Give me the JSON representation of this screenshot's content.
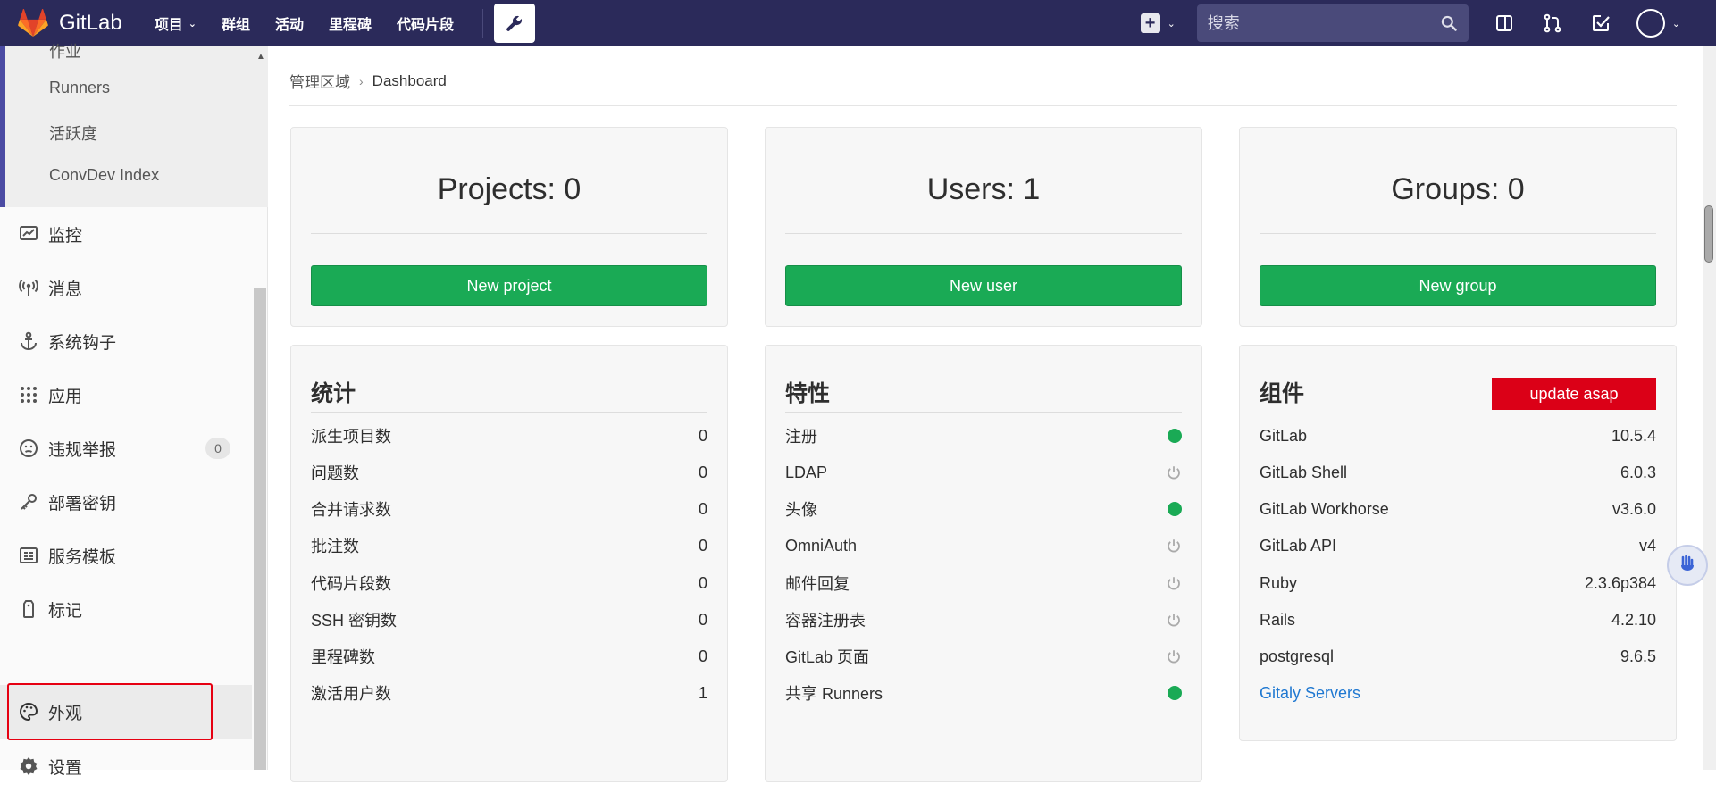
{
  "navbar": {
    "brand": "GitLab",
    "links": [
      {
        "label": "项目",
        "dropdown": true
      },
      {
        "label": "群组"
      },
      {
        "label": "活动"
      },
      {
        "label": "里程碑"
      },
      {
        "label": "代码片段"
      }
    ],
    "search_placeholder": "搜索",
    "accent": "#2b2a5a"
  },
  "sidebar": {
    "sub_items": [
      "作业",
      "Runners",
      "活跃度",
      "ConvDev Index"
    ],
    "items": [
      {
        "label": "监控",
        "icon": "monitor-icon"
      },
      {
        "label": "消息",
        "icon": "broadcast-icon"
      },
      {
        "label": "系统钩子",
        "icon": "anchor-icon"
      },
      {
        "label": "应用",
        "icon": "grid-icon"
      },
      {
        "label": "违规举报",
        "icon": "abuse-icon",
        "badge": "0"
      },
      {
        "label": "部署密钥",
        "icon": "key-icon"
      },
      {
        "label": "服务模板",
        "icon": "template-icon"
      },
      {
        "label": "标记",
        "icon": "label-icon"
      },
      {
        "label": "外观",
        "icon": "palette-icon",
        "active": true
      },
      {
        "label": "设置",
        "icon": "gear-icon"
      }
    ]
  },
  "breadcrumb": {
    "parent": "管理区域",
    "current": "Dashboard"
  },
  "stats": [
    {
      "title": "Projects: 0",
      "button": "New project"
    },
    {
      "title": "Users: 1",
      "button": "New user"
    },
    {
      "title": "Groups: 0",
      "button": "New group"
    }
  ],
  "statistics": {
    "title": "统计",
    "rows": [
      {
        "label": "派生项目数",
        "value": "0"
      },
      {
        "label": "问题数",
        "value": "0"
      },
      {
        "label": "合并请求数",
        "value": "0"
      },
      {
        "label": "批注数",
        "value": "0"
      },
      {
        "label": "代码片段数",
        "value": "0"
      },
      {
        "label": "SSH 密钥数",
        "value": "0"
      },
      {
        "label": "里程碑数",
        "value": "0"
      },
      {
        "label": "激活用户数",
        "value": "1"
      }
    ]
  },
  "features": {
    "title": "特性",
    "rows": [
      {
        "label": "注册",
        "enabled": true
      },
      {
        "label": "LDAP",
        "enabled": false
      },
      {
        "label": "头像",
        "enabled": true
      },
      {
        "label": "OmniAuth",
        "enabled": false
      },
      {
        "label": "邮件回复",
        "enabled": false
      },
      {
        "label": "容器注册表",
        "enabled": false
      },
      {
        "label": "GitLab 页面",
        "enabled": false
      },
      {
        "label": "共享 Runners",
        "enabled": true
      }
    ],
    "enabled_color": "#1aaa55"
  },
  "components": {
    "title": "组件",
    "update_label": "update asap",
    "rows": [
      {
        "label": "GitLab",
        "value": "10.5.4"
      },
      {
        "label": "GitLab Shell",
        "value": "6.0.3"
      },
      {
        "label": "GitLab Workhorse",
        "value": "v3.6.0"
      },
      {
        "label": "GitLab API",
        "value": "v4"
      },
      {
        "label": "Ruby",
        "value": "2.3.6p384"
      },
      {
        "label": "Rails",
        "value": "4.2.10"
      },
      {
        "label": "postgresql",
        "value": "9.6.5"
      }
    ],
    "gitaly_link": "Gitaly Servers"
  }
}
